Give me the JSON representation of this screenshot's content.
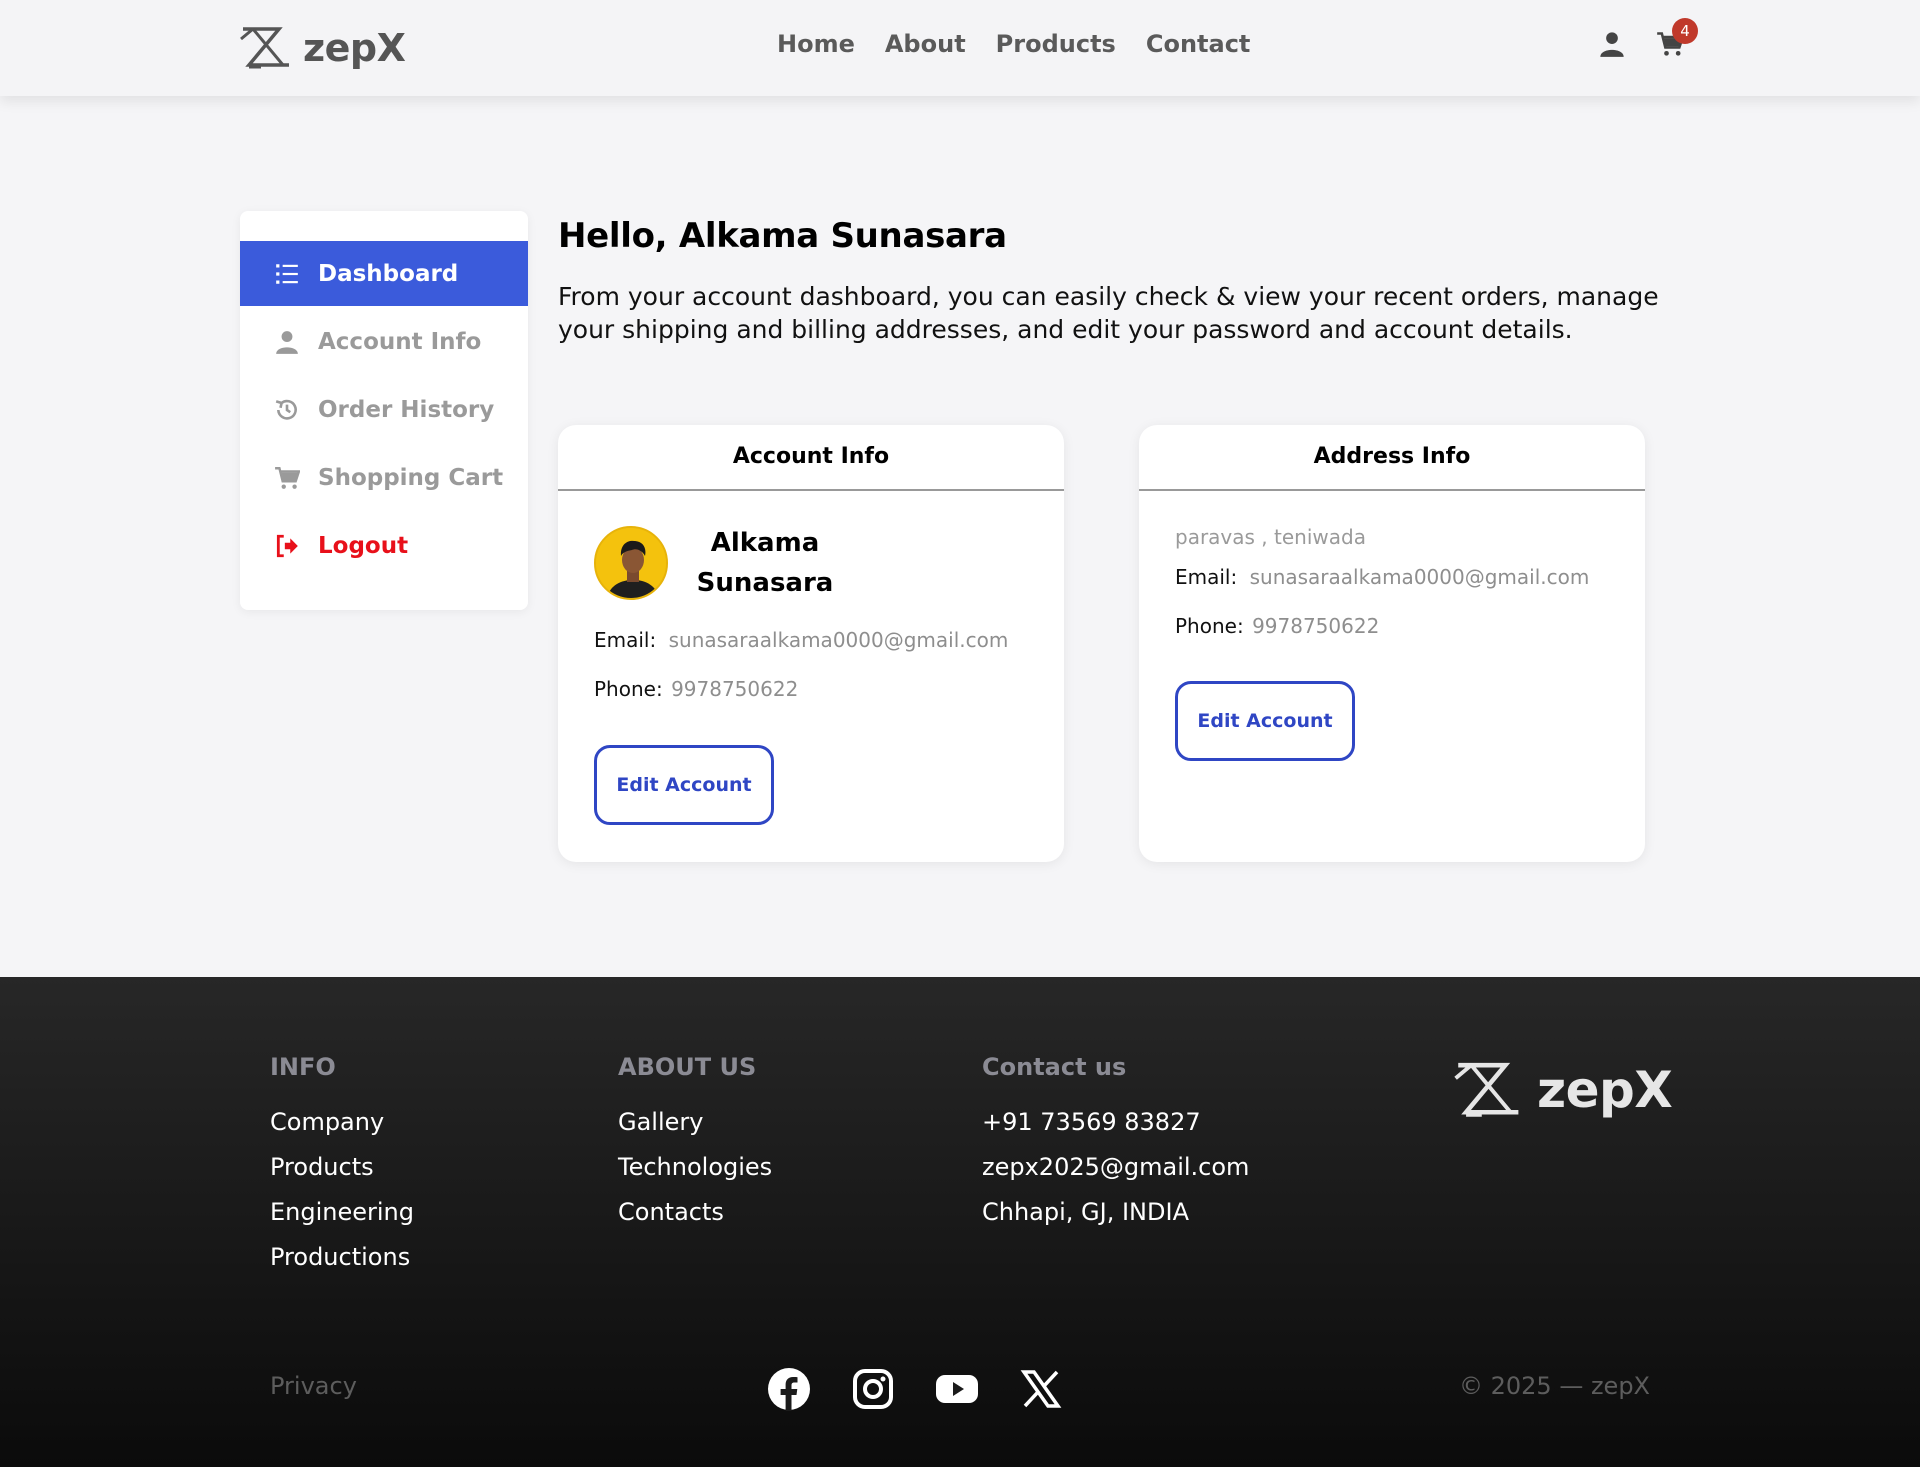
{
  "brand": {
    "name": "zepX"
  },
  "nav": [
    {
      "label": "Home"
    },
    {
      "label": "About"
    },
    {
      "label": "Products"
    },
    {
      "label": "Contact"
    }
  ],
  "header": {
    "cart_count": "4",
    "user_icon": "user-icon",
    "cart_icon": "cart-icon"
  },
  "sidebar": {
    "items": [
      {
        "label": "Dashboard",
        "icon": "list-icon",
        "active": true
      },
      {
        "label": "Account Info",
        "icon": "user-icon"
      },
      {
        "label": "Order History",
        "icon": "history-icon"
      },
      {
        "label": "Shopping Cart",
        "icon": "cart-icon"
      },
      {
        "label": "Logout",
        "icon": "logout-icon"
      }
    ]
  },
  "main": {
    "greeting": "Hello, Alkama Sunasara",
    "intro": "From your account dashboard, you can easily check & view your recent orders, manage your shipping and billing addresses, and edit your password and account details."
  },
  "account_card": {
    "title": "Account Info",
    "name_first": "Alkama",
    "name_last": "Sunasara",
    "email_label": "Email:",
    "email": "sunasaraalkama0000@gmail.com",
    "phone_label": "Phone:",
    "phone": "9978750622",
    "button": "Edit Account"
  },
  "address_card": {
    "title": "Address Info",
    "address": "paravas , teniwada",
    "email_label": "Email:",
    "email": "sunasaraalkama0000@gmail.com",
    "phone_label": "Phone:",
    "phone": "9978750622",
    "button": "Edit Account"
  },
  "footer": {
    "info": {
      "heading": "INFO",
      "links": [
        "Company",
        "Products",
        "Engineering",
        "Productions"
      ]
    },
    "about": {
      "heading": "ABOUT US",
      "links": [
        "Gallery",
        "Technologies",
        "Contacts"
      ]
    },
    "contact": {
      "heading": "Contact us",
      "links": [
        "+91 73569 83827",
        "zepx2025@gmail.com",
        "Chhapi, GJ, INDIA"
      ]
    },
    "privacy": "Privacy",
    "copyright": "© 2025 — zepX",
    "socials": [
      "facebook-icon",
      "instagram-icon",
      "youtube-icon",
      "x-icon"
    ]
  },
  "colors": {
    "accent": "#3b5bdb",
    "button_border": "#2f46c4",
    "logout": "#e8101a",
    "badge": "#c0392b"
  }
}
